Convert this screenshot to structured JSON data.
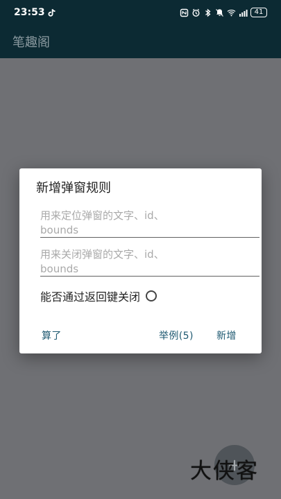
{
  "status_bar": {
    "time": "23:53",
    "battery": "41",
    "icons": [
      "tiktok-icon",
      "nfc-icon",
      "alarm-icon",
      "bluetooth-icon",
      "mute-icon",
      "wifi-icon",
      "signal-icon",
      "battery-icon"
    ]
  },
  "app_bar": {
    "title": "笔趣阁"
  },
  "dialog": {
    "title": "新增弹窗规则",
    "locate_input": {
      "value": "",
      "placeholder": "用来定位弹窗的文字、id、\nbounds"
    },
    "close_input": {
      "value": "",
      "placeholder": "用来关闭弹窗的文字、id、\nbounds"
    },
    "back_close_label": "能否通过返回键关闭",
    "back_close_checked": false,
    "actions": {
      "cancel": "算了",
      "example": "举例(5)",
      "add": "新增"
    }
  },
  "fab": {
    "icon": "plus-icon"
  },
  "watermark": {
    "text": "大侠客"
  },
  "colors": {
    "status_bar_bg": "#0c2a33",
    "background": "#6f7074",
    "dialog_bg": "#ffffff",
    "action_text": "#1d5870"
  }
}
